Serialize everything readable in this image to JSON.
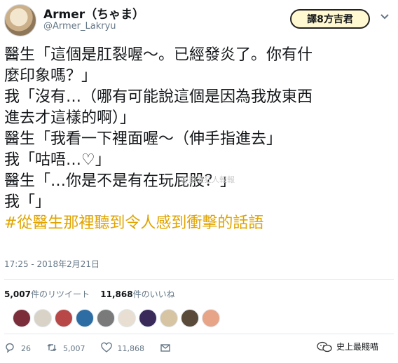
{
  "header": {
    "display_name": "Armer（ちゃま）",
    "handle": "@Armer_Lakryu",
    "logo_text": "譯8方吉君",
    "menu_icon": "chevron-down-icon"
  },
  "tweet": {
    "lines": [
      "醫生「這個是肛裂喔～。已經發炎了。你有什",
      "麼印象嗎？」",
      "我「沒有…（哪有可能說這個是因為我放東西",
      "進去才這樣的啊）」",
      "醫生「我看一下裡面喔～（伸手指進去」",
      "我「咕唔…♡」",
      "醫生「…你是不是有在玩屁股？」",
      "我「」"
    ],
    "hashtag": "#從醫生那裡聽到令人感到衝擊的話語",
    "timestamp": "17:25 - 2018年2月21日"
  },
  "stats": {
    "retweets_count": "5,007",
    "retweets_label": "件のリツイート",
    "likes_count": "11,868",
    "likes_label": "件のいいね"
  },
  "likers": [
    "#7b2d3a",
    "#d9d3c7",
    "#b84848",
    "#2e6da4",
    "#7a7a7a",
    "#e8dfd2",
    "#3a2a5a",
    "#d6c4a3",
    "#5a4a3a",
    "#e7a487"
  ],
  "actions": {
    "reply_count": "26",
    "retweet_count": "5,007",
    "like_count": "11,868"
  },
  "watermarks": {
    "center": "@重灌狂人報報",
    "brand": "史上最賤喵"
  },
  "colors": {
    "hashtag": "#e0a400",
    "secondary_text": "#657786"
  }
}
